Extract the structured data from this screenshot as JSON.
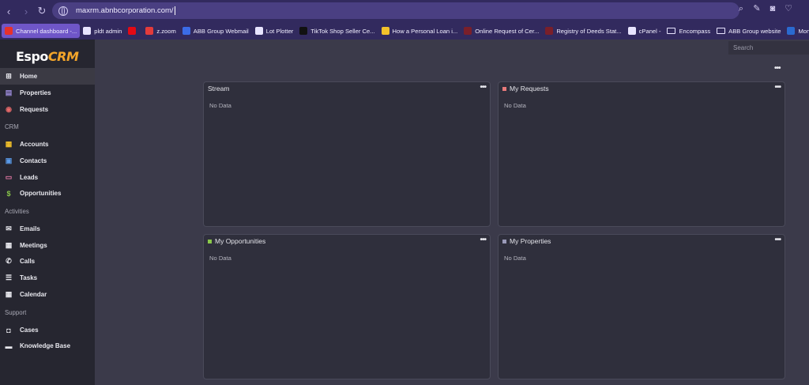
{
  "browser": {
    "url": "maxrm.abnbcorporation.com/",
    "bookmarks": [
      {
        "label": "Channel dashboard -...",
        "color": "#e8312a",
        "active": true
      },
      {
        "label": "pldt admin",
        "color": "#e8e4ff"
      },
      {
        "label": "",
        "color": "#e50914"
      },
      {
        "label": "z.zoom",
        "color": "#e43b3b"
      },
      {
        "label": "ABB Group Webmail",
        "color": "#3b6ce8"
      },
      {
        "label": "Lot Plotter",
        "color": "#e8e4ff"
      },
      {
        "label": "TikTok Shop Seller Ce...",
        "color": "#111111"
      },
      {
        "label": "How a Personal Loan i...",
        "color": "#f3c12a"
      },
      {
        "label": "Online Request of Cer...",
        "color": "#7a1f2a"
      },
      {
        "label": "Registry of Deeds Stat...",
        "color": "#7a1f2a"
      },
      {
        "label": "cPanel -",
        "color": "#e8e4ff"
      },
      {
        "label": "Encompass",
        "color": "folder"
      },
      {
        "label": "ABB Group website",
        "color": "folder"
      },
      {
        "label": "Moncello Crest Com",
        "color": "#2a6ad0"
      }
    ]
  },
  "app": {
    "logo_main": "Espo",
    "logo_accent": "CRM",
    "search_placeholder": "Search",
    "nav": [
      {
        "label": "Home",
        "icon": "home-grid-icon",
        "glyph": "⊞",
        "color": "#e8e8ee"
      },
      {
        "label": "Properties",
        "icon": "building-icon",
        "glyph": "▤",
        "color": "#9a8ad8"
      },
      {
        "label": "Requests",
        "icon": "target-icon",
        "glyph": "◉",
        "color": "#e86a6a"
      },
      {
        "label": "Accounts",
        "icon": "accounts-icon",
        "glyph": "▦",
        "color": "#f3c12a"
      },
      {
        "label": "Contacts",
        "icon": "contacts-icon",
        "glyph": "▣",
        "color": "#5a9ae8"
      },
      {
        "label": "Leads",
        "icon": "leads-icon",
        "glyph": "▭",
        "color": "#e87aa8"
      },
      {
        "label": "Opportunities",
        "icon": "dollar-icon",
        "glyph": "$",
        "color": "#8ac84a"
      },
      {
        "label": "Emails",
        "icon": "envelope-icon",
        "glyph": "✉",
        "color": "#e8e8ee"
      },
      {
        "label": "Meetings",
        "icon": "meeting-icon",
        "glyph": "▦",
        "color": "#e8e8ee"
      },
      {
        "label": "Calls",
        "icon": "phone-icon",
        "glyph": "✆",
        "color": "#e8e8ee"
      },
      {
        "label": "Tasks",
        "icon": "tasks-icon",
        "glyph": "☰",
        "color": "#e8e8ee"
      },
      {
        "label": "Calendar",
        "icon": "calendar-icon",
        "glyph": "▦",
        "color": "#e8e8ee"
      },
      {
        "label": "Cases",
        "icon": "briefcase-icon",
        "glyph": "◘",
        "color": "#e8e8ee"
      },
      {
        "label": "Knowledge Base",
        "icon": "book-icon",
        "glyph": "▬",
        "color": "#e8e8ee"
      }
    ],
    "categories": [
      "CRM",
      "Activities",
      "Support"
    ],
    "dashlets": [
      {
        "title": "Stream",
        "empty": "No Data",
        "marker": ""
      },
      {
        "title": "My Requests",
        "empty": "No Data",
        "marker": "#e87a7a"
      },
      {
        "title": "My Opportunities",
        "empty": "No Data",
        "marker": "#8ac84a"
      },
      {
        "title": "My Properties",
        "empty": "No Data",
        "marker": "#9a9ab8"
      }
    ],
    "dots": "•••"
  }
}
